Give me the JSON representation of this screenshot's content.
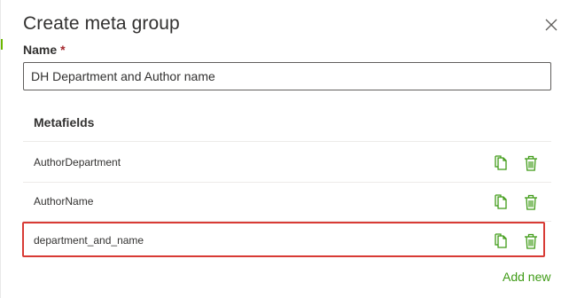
{
  "dialog": {
    "title": "Create meta group",
    "close_icon": "close-icon"
  },
  "name_field": {
    "label": "Name",
    "required_marker": "*",
    "value": "DH Department and Author name"
  },
  "metafields": {
    "header": "Metafields",
    "rows": [
      {
        "label": "AuthorDepartment",
        "highlighted": false
      },
      {
        "label": "AuthorName",
        "highlighted": false
      },
      {
        "label": "department_and_name",
        "highlighted": true
      }
    ],
    "row_icons": [
      "copy-icon",
      "delete-icon"
    ]
  },
  "actions": {
    "add_new_label": "Add new"
  },
  "colors": {
    "accent_green": "#3f9b16",
    "highlight_red": "#d83b35",
    "required_red": "#a4262c"
  }
}
